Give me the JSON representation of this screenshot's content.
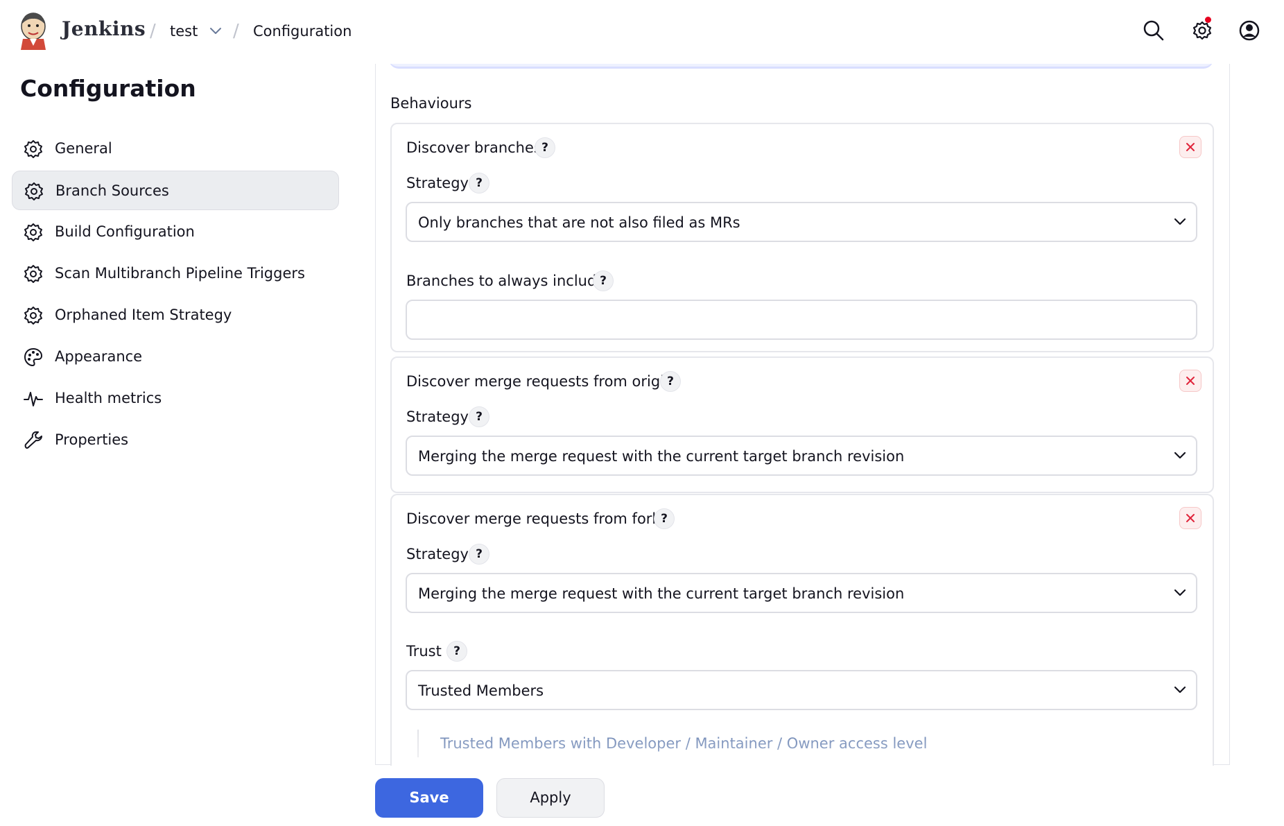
{
  "header": {
    "brand": "Jenkins",
    "breadcrumbs": [
      {
        "label": "test"
      },
      {
        "label": "Configuration"
      }
    ],
    "icons": [
      "search-icon",
      "manage-jenkins-gear-icon",
      "user-account-icon"
    ],
    "notification_color": "#e6001f"
  },
  "sidebar": {
    "title": "Configuration",
    "items": [
      {
        "label": "General",
        "icon": "gear-icon"
      },
      {
        "label": "Branch Sources",
        "icon": "gear-icon",
        "active": true
      },
      {
        "label": "Build Configuration",
        "icon": "gear-icon"
      },
      {
        "label": "Scan Multibranch Pipeline Triggers",
        "icon": "gear-icon"
      },
      {
        "label": "Orphaned Item Strategy",
        "icon": "gear-icon"
      },
      {
        "label": "Appearance",
        "icon": "palette-icon"
      },
      {
        "label": "Health metrics",
        "icon": "pulse-icon"
      },
      {
        "label": "Properties",
        "icon": "wrench-icon"
      }
    ]
  },
  "main": {
    "section_label": "Behaviours",
    "help_glyph": "?",
    "cards": [
      {
        "title": "Discover branches",
        "strategy_label": "Strategy",
        "strategy_value": "Only branches that are not also filed as MRs",
        "include_label": "Branches to always include",
        "include_value": ""
      },
      {
        "title": "Discover merge requests from origin",
        "strategy_label": "Strategy",
        "strategy_value": "Merging the merge request with the current target branch revision"
      },
      {
        "title": "Discover merge requests from forks",
        "strategy_label": "Strategy",
        "strategy_value": "Merging the merge request with the current target branch revision",
        "trust_label": "Trust",
        "trust_value": "Trusted Members",
        "trust_description": "Trusted Members with Developer / Maintainer / Owner access level"
      }
    ]
  },
  "actions": {
    "save_label": "Save",
    "apply_label": "Apply",
    "primary_color": "#3d67e0"
  }
}
